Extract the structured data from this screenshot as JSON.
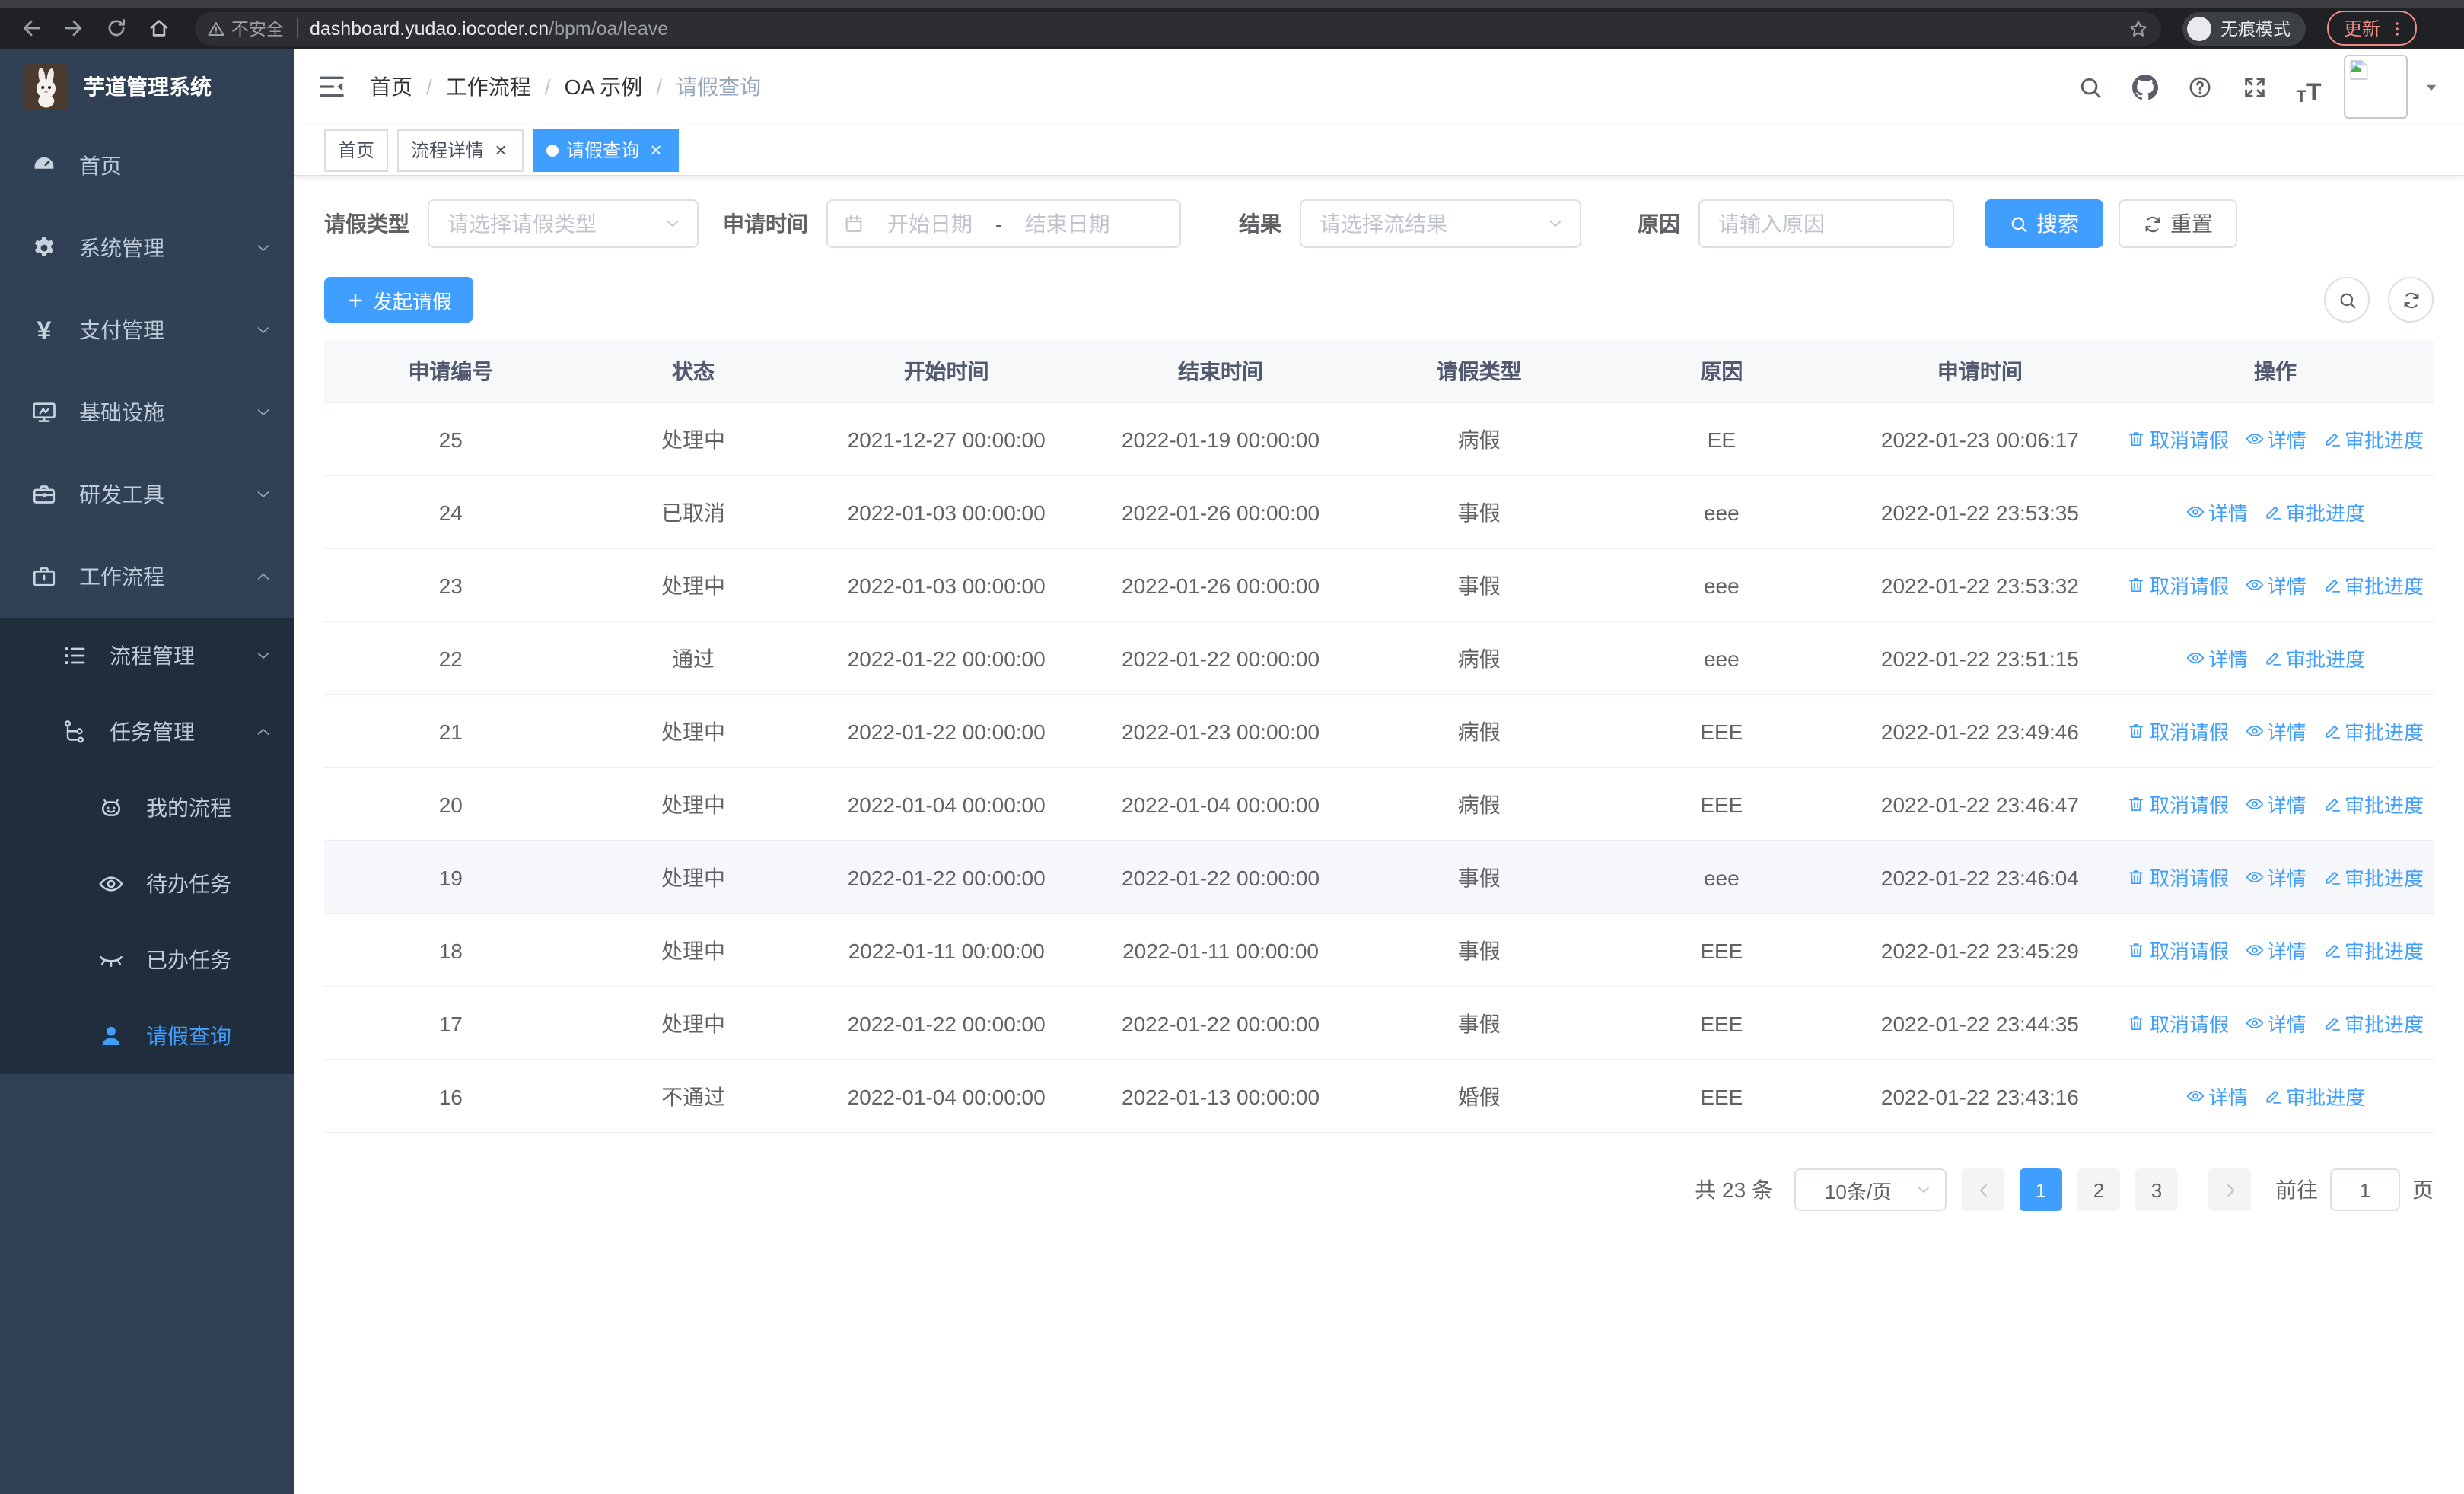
{
  "browser": {
    "security_label": "不安全",
    "url_host": "dashboard.yudao.iocoder.cn",
    "url_path": "/bpm/oa/leave",
    "incognito_label": "无痕模式",
    "update_label": "更新",
    "nav_icons": [
      "back-icon",
      "forward-icon",
      "reload-icon",
      "home-icon"
    ]
  },
  "app": {
    "logo_title": "芋道管理系统",
    "accent_color": "#409EFF",
    "sidebar_bg": "#304156",
    "submenu_bg": "#1f2d3d"
  },
  "sidebar": {
    "menu": [
      {
        "label": "首页",
        "icon": "dashboard-icon",
        "arrow": "",
        "active": false
      },
      {
        "label": "系统管理",
        "icon": "gear-icon",
        "arrow": "down",
        "active": false
      },
      {
        "label": "支付管理",
        "icon": "yen-icon",
        "arrow": "down",
        "active": false
      },
      {
        "label": "基础设施",
        "icon": "monitor-icon",
        "arrow": "down",
        "active": false
      },
      {
        "label": "研发工具",
        "icon": "toolbox-icon",
        "arrow": "down",
        "active": false
      },
      {
        "label": "工作流程",
        "icon": "briefcase-icon",
        "arrow": "up",
        "active": false
      }
    ],
    "submenu": [
      {
        "label": "流程管理",
        "icon": "flow-list-icon",
        "arrow": "down",
        "level": 2,
        "active": false
      },
      {
        "label": "任务管理",
        "icon": "task-tree-icon",
        "arrow": "up",
        "level": 2,
        "active": false
      },
      {
        "label": "我的流程",
        "icon": "robot-icon",
        "arrow": "",
        "level": 3,
        "active": false
      },
      {
        "label": "待办任务",
        "icon": "eye-icon",
        "arrow": "",
        "level": 3,
        "active": false
      },
      {
        "label": "已办任务",
        "icon": "eye-closed-icon",
        "arrow": "",
        "level": 3,
        "active": false
      },
      {
        "label": "请假查询",
        "icon": "user-icon",
        "arrow": "",
        "level": 3,
        "active": true
      }
    ]
  },
  "header": {
    "breadcrumb": [
      "首页",
      "工作流程",
      "OA 示例",
      "请假查询"
    ],
    "action_icons": [
      "search-icon",
      "github-icon",
      "help-icon",
      "fullscreen-icon",
      "font-size-icon"
    ]
  },
  "tabs": [
    {
      "label": "首页",
      "closable": false,
      "active": false
    },
    {
      "label": "流程详情",
      "closable": true,
      "active": false
    },
    {
      "label": "请假查询",
      "closable": true,
      "active": true
    }
  ],
  "filters": {
    "leave_type": {
      "label": "请假类型",
      "placeholder": "请选择请假类型"
    },
    "apply_time": {
      "label": "申请时间",
      "start_placeholder": "开始日期",
      "separator": "-",
      "end_placeholder": "结束日期"
    },
    "result": {
      "label": "结果",
      "placeholder": "请选择流结果"
    },
    "reason": {
      "label": "原因",
      "placeholder": "请输入原因"
    },
    "search_label": "搜索",
    "reset_label": "重置"
  },
  "toolbar": {
    "create_label": "发起请假"
  },
  "table": {
    "columns": [
      "申请编号",
      "状态",
      "开始时间",
      "结束时间",
      "请假类型",
      "原因",
      "申请时间",
      "操作"
    ],
    "action_labels": {
      "cancel": "取消请假",
      "detail": "详情",
      "progress": "审批进度"
    },
    "action_icons": {
      "cancel": "trash-icon",
      "detail": "view-icon",
      "progress": "edit-icon"
    },
    "rows": [
      {
        "id": "25",
        "status": "处理中",
        "start": "2021-12-27 00:00:00",
        "end": "2022-01-19 00:00:00",
        "type": "病假",
        "reason": "EE",
        "applied": "2022-01-23 00:06:17",
        "actions": [
          "cancel",
          "detail",
          "progress"
        ],
        "highlighted": false
      },
      {
        "id": "24",
        "status": "已取消",
        "start": "2022-01-03 00:00:00",
        "end": "2022-01-26 00:00:00",
        "type": "事假",
        "reason": "eee",
        "applied": "2022-01-22 23:53:35",
        "actions": [
          "detail",
          "progress"
        ],
        "highlighted": false
      },
      {
        "id": "23",
        "status": "处理中",
        "start": "2022-01-03 00:00:00",
        "end": "2022-01-26 00:00:00",
        "type": "事假",
        "reason": "eee",
        "applied": "2022-01-22 23:53:32",
        "actions": [
          "cancel",
          "detail",
          "progress"
        ],
        "highlighted": false
      },
      {
        "id": "22",
        "status": "通过",
        "start": "2022-01-22 00:00:00",
        "end": "2022-01-22 00:00:00",
        "type": "病假",
        "reason": "eee",
        "applied": "2022-01-22 23:51:15",
        "actions": [
          "detail",
          "progress"
        ],
        "highlighted": false
      },
      {
        "id": "21",
        "status": "处理中",
        "start": "2022-01-22 00:00:00",
        "end": "2022-01-23 00:00:00",
        "type": "病假",
        "reason": "EEE",
        "applied": "2022-01-22 23:49:46",
        "actions": [
          "cancel",
          "detail",
          "progress"
        ],
        "highlighted": false
      },
      {
        "id": "20",
        "status": "处理中",
        "start": "2022-01-04 00:00:00",
        "end": "2022-01-04 00:00:00",
        "type": "病假",
        "reason": "EEE",
        "applied": "2022-01-22 23:46:47",
        "actions": [
          "cancel",
          "detail",
          "progress"
        ],
        "highlighted": false
      },
      {
        "id": "19",
        "status": "处理中",
        "start": "2022-01-22 00:00:00",
        "end": "2022-01-22 00:00:00",
        "type": "事假",
        "reason": "eee",
        "applied": "2022-01-22 23:46:04",
        "actions": [
          "cancel",
          "detail",
          "progress"
        ],
        "highlighted": true
      },
      {
        "id": "18",
        "status": "处理中",
        "start": "2022-01-11 00:00:00",
        "end": "2022-01-11 00:00:00",
        "type": "事假",
        "reason": "EEE",
        "applied": "2022-01-22 23:45:29",
        "actions": [
          "cancel",
          "detail",
          "progress"
        ],
        "highlighted": false
      },
      {
        "id": "17",
        "status": "处理中",
        "start": "2022-01-22 00:00:00",
        "end": "2022-01-22 00:00:00",
        "type": "事假",
        "reason": "EEE",
        "applied": "2022-01-22 23:44:35",
        "actions": [
          "cancel",
          "detail",
          "progress"
        ],
        "highlighted": false
      },
      {
        "id": "16",
        "status": "不通过",
        "start": "2022-01-04 00:00:00",
        "end": "2022-01-13 00:00:00",
        "type": "婚假",
        "reason": "EEE",
        "applied": "2022-01-22 23:43:16",
        "actions": [
          "detail",
          "progress"
        ],
        "highlighted": false
      }
    ]
  },
  "pagination": {
    "total_label": "共 23 条",
    "page_size_label": "10条/页",
    "pages": [
      "1",
      "2",
      "3"
    ],
    "active_page": "1",
    "goto_label": "前往",
    "goto_value": "1",
    "goto_suffix": "页"
  },
  "icons": {
    "back-icon": "left-arrow",
    "forward-icon": "right-arrow",
    "reload-icon": "circular-arrow",
    "home-icon": "house",
    "warning-icon": "triangle-exclamation",
    "star-icon": "bookmark-star",
    "incognito-icon": "spy-hat-glasses",
    "kebab-icon": "three-vertical-dots",
    "collapse-sidebar-icon": "hamburger-with-arrow",
    "search-icon": "magnifier",
    "github-icon": "octocat",
    "help-icon": "question-circle",
    "fullscreen-icon": "expand-arrows",
    "font-size-icon": "double-T",
    "broken-image-icon": "image-placeholder",
    "caret-down-icon": "small-triangle",
    "dashboard-icon": "gauge",
    "gear-icon": "cog",
    "yen-icon": "yen-sign",
    "monitor-icon": "screen-with-check",
    "toolbox-icon": "toolbox",
    "briefcase-icon": "briefcase",
    "flow-list-icon": "indented-list",
    "task-tree-icon": "branch-nodes",
    "robot-icon": "robot-face",
    "eye-icon": "open-eye",
    "eye-closed-icon": "closed-eye",
    "user-icon": "person-silhouette",
    "plus-icon": "plus",
    "calendar-icon": "calendar",
    "chevron-down-icon": "chevron-down",
    "refresh-icon": "refresh-arrows",
    "trash-icon": "trash-can",
    "view-icon": "open-eye",
    "edit-icon": "pen"
  }
}
